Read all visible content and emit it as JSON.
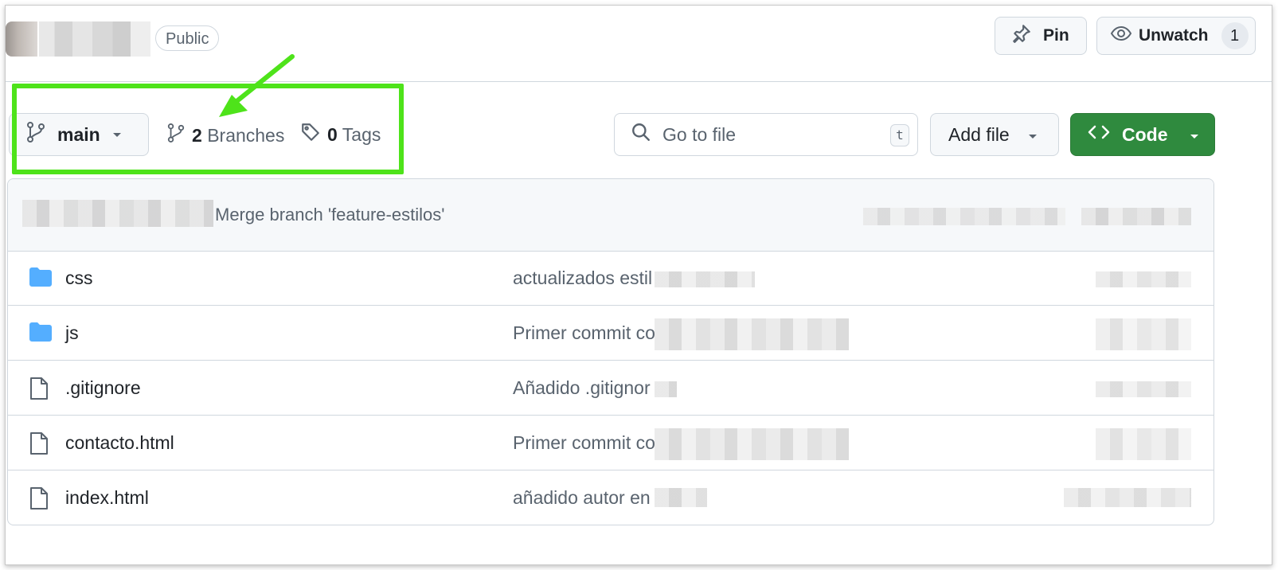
{
  "header": {
    "visibility_badge": "Public",
    "pin_label": "Pin",
    "unwatch_label": "Unwatch",
    "watch_count": "1"
  },
  "toolbar": {
    "branch_name": "main",
    "branches_count": "2",
    "branches_label": "Branches",
    "tags_count": "0",
    "tags_label": "Tags",
    "search_placeholder": "Go to file",
    "search_shortcut": "t",
    "add_file_label": "Add file",
    "code_label": "Code",
    "code_button_color": "#2f8a3e"
  },
  "annotation": {
    "highlight_color": "#4ee31a"
  },
  "latest_commit": {
    "message": "Merge branch 'feature-estilos'"
  },
  "files": [
    {
      "name": "css",
      "type": "folder",
      "icon": "folder-icon",
      "message": "actualizados estil"
    },
    {
      "name": "js",
      "type": "folder",
      "icon": "folder-icon",
      "message": "Primer commit co"
    },
    {
      "name": ".gitignore",
      "type": "file",
      "icon": "file-icon",
      "message": "Añadido .gitignor"
    },
    {
      "name": "contacto.html",
      "type": "file",
      "icon": "file-icon",
      "message": "Primer commit co"
    },
    {
      "name": "index.html",
      "type": "file",
      "icon": "file-icon",
      "message": "añadido autor en"
    }
  ]
}
